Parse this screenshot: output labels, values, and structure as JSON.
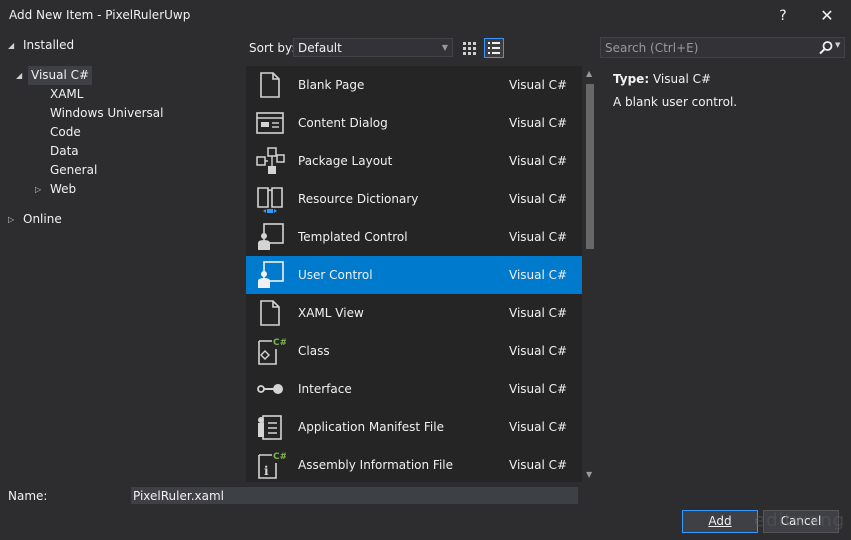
{
  "window": {
    "title": "Add New Item - PixelRulerUwp",
    "help_glyph": "?",
    "close_glyph": "✕"
  },
  "tree": {
    "installed": "Installed",
    "visual_csharp": "Visual C#",
    "children": [
      "XAML",
      "Windows Universal",
      "Code",
      "Data",
      "General",
      "Web"
    ],
    "online": "Online"
  },
  "toolbar": {
    "sort_label": "Sort by:",
    "sort_value": "Default",
    "search_placeholder": "Search (Ctrl+E)"
  },
  "items": [
    {
      "name": "Blank Page",
      "lang": "Visual C#",
      "icon": "page-icon"
    },
    {
      "name": "Content Dialog",
      "lang": "Visual C#",
      "icon": "dialog-icon"
    },
    {
      "name": "Package Layout",
      "lang": "Visual C#",
      "icon": "package-layout-icon"
    },
    {
      "name": "Resource Dictionary",
      "lang": "Visual C#",
      "icon": "resource-dictionary-icon"
    },
    {
      "name": "Templated Control",
      "lang": "Visual C#",
      "icon": "templated-control-icon"
    },
    {
      "name": "User Control",
      "lang": "Visual C#",
      "icon": "user-control-icon",
      "selected": true
    },
    {
      "name": "XAML View",
      "lang": "Visual C#",
      "icon": "page-icon"
    },
    {
      "name": "Class",
      "lang": "Visual C#",
      "icon": "class-icon"
    },
    {
      "name": "Interface",
      "lang": "Visual C#",
      "icon": "interface-icon"
    },
    {
      "name": "Application Manifest File",
      "lang": "Visual C#",
      "icon": "manifest-icon"
    },
    {
      "name": "Assembly Information File",
      "lang": "Visual C#",
      "icon": "assembly-info-icon"
    }
  ],
  "details": {
    "type_label": "Type:",
    "type_value": "Visual C#",
    "description": "A blank user control."
  },
  "footer": {
    "name_label": "Name:",
    "name_value": "PixelRuler.xaml",
    "add_label": "Add",
    "cancel_label": "Cancel",
    "watermark": "editwang"
  },
  "colors": {
    "background": "#2d2d30",
    "list_background": "#252526",
    "selection": "#007acc",
    "accent": "#3399ff",
    "csharp_badge": "#7ab648"
  }
}
